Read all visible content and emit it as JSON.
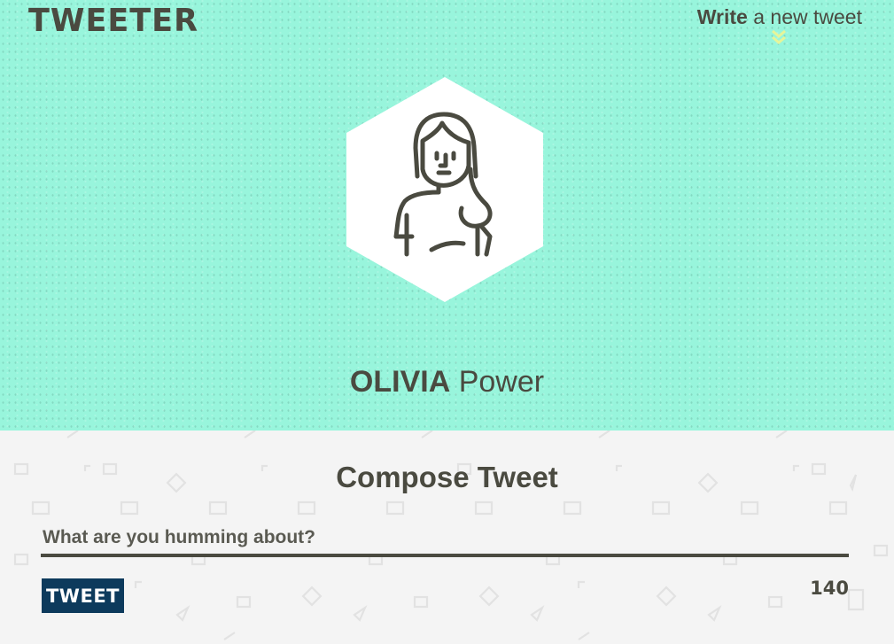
{
  "header": {
    "logo": "TWEETER",
    "nav": {
      "write_bold": "Write",
      "write_rest": " a new tweet"
    }
  },
  "profile": {
    "first_name": "OLIVIA",
    "last_name": "Power",
    "avatar_icon": "woman-avatar-icon"
  },
  "compose": {
    "title": "Compose Tweet",
    "placeholder": "What are you humming about?",
    "tweet_button": "TWEET",
    "char_count": "140"
  },
  "colors": {
    "hero_bg": "#98f5dc",
    "compose_bg": "#f4f4f4",
    "text": "#4a4a40",
    "button_bg": "#0d3a5c",
    "chevron": "#e6f59a"
  }
}
